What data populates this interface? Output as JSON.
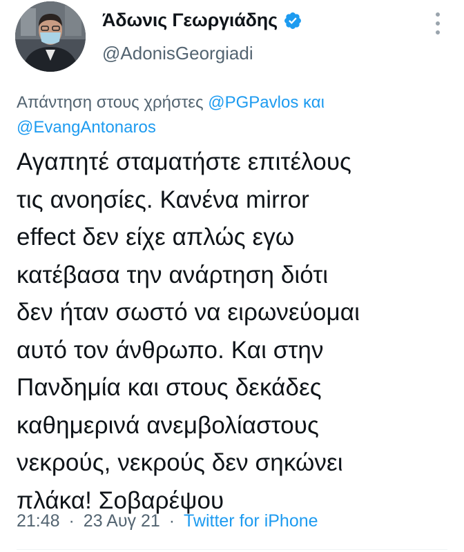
{
  "author": {
    "display_name": "Άδωνις Γεωργιάδης",
    "handle": "@AdonisGeorgiadi",
    "verified": true,
    "avatar_icon": "profile-photo",
    "verified_icon": "verified-badge-icon",
    "more_icon": "more-vertical-icon"
  },
  "reply": {
    "prefix": "Απάντηση στους χρήστες",
    "mention_1": "@PGPavlos",
    "conjunction": "και",
    "mention_2": "@EvangAntonaros"
  },
  "tweet": {
    "lines": [
      "Αγαπητέ σταματήστε επιτέλους",
      "τις ανοησίες. Κανένα mirror",
      "effect δεν είχε απλώς εγω",
      "κατέβασα την ανάρτηση διότι",
      "δεν ήταν σωστό να ειρωνεύομαι",
      "αυτό τον άνθρωπο. Και στην",
      "Πανδημία και στους δεκάδες",
      "καθημερινά ανεμβολίαστους",
      "νεκρούς, νεκρούς δεν σηκώνει",
      "πλάκα! Σοβαρέψου"
    ]
  },
  "meta": {
    "time": "21:48",
    "separator": "·",
    "date": "23 Αυγ 21",
    "source": "Twitter for iPhone"
  },
  "colors": {
    "text": "#0f1419",
    "secondary": "#536471",
    "link": "#1d9bf0",
    "verified": "#1d9bf0"
  }
}
